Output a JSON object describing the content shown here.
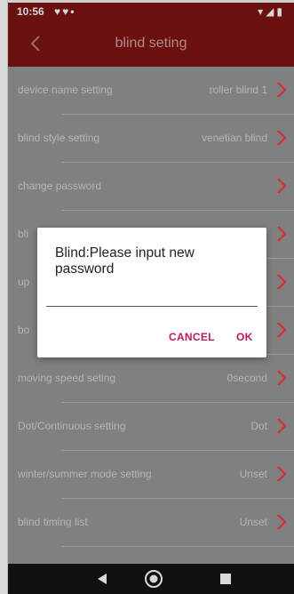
{
  "status_bar": {
    "time": "10:56",
    "notification_icons": [
      "heart-icon",
      "heart-icon"
    ],
    "system_icons": [
      "wifi-icon",
      "signal-icon",
      "battery-icon"
    ]
  },
  "app_bar": {
    "title": "blind seting",
    "back_icon": "chevron-left-icon"
  },
  "settings": [
    {
      "label": "device name setting",
      "value": "roller blind 1"
    },
    {
      "label": "blind style setting",
      "value": "venetian blind"
    },
    {
      "label": "change password",
      "value": ""
    },
    {
      "label": "bli",
      "value": ""
    },
    {
      "label": "up",
      "value": ""
    },
    {
      "label": "bo",
      "value": ""
    },
    {
      "label": "moving speed seting",
      "value": "0second"
    },
    {
      "label": "Dot/Continuous setting",
      "value": "Dot"
    },
    {
      "label": "winter/summer mode setting",
      "value": "Unset"
    },
    {
      "label": "blind timing list",
      "value": "Unset"
    }
  ],
  "dialog": {
    "message": "Blind:Please input new password",
    "input_value": "",
    "cancel_label": "CANCEL",
    "ok_label": "OK"
  },
  "colors": {
    "app_bar": "#6a1110",
    "chevron": "#d32f2f",
    "dialog_button": "#c2185b"
  },
  "nav_bar": {
    "icons": [
      "back-triangle-icon",
      "home-circle-icon",
      "recents-square-icon"
    ]
  }
}
